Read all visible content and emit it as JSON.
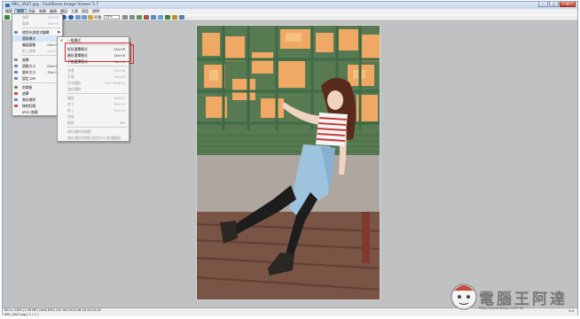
{
  "window": {
    "title": "IMG_3547.jpg - FastStone Image Viewer 5.7",
    "minimize": "—",
    "maximize": "□",
    "close": "✕"
  },
  "menubar": [
    "檔案",
    "編輯",
    "色彩",
    "效果",
    "檢視",
    "標記",
    "工具",
    "設定",
    "說明"
  ],
  "toolbar": {
    "zoom_value": "32%",
    "fit_label": "平滑"
  },
  "edit_menu": [
    {
      "label": "復原",
      "shortcut": "Ctrl+Z",
      "disabled": true
    },
    {
      "label": "重做",
      "shortcut": "Ctrl+Y",
      "disabled": true
    },
    {
      "label": "使用外部程式編輯",
      "shortcut": "",
      "disabled": false,
      "submenu": true
    },
    {
      "label": "選取模式",
      "shortcut": "",
      "disabled": false,
      "submenu": true,
      "highlight": true
    },
    {
      "label": "複製圖像",
      "shortcut": "Ctrl+C",
      "disabled": false
    },
    {
      "label": "貼上圖像",
      "shortcut": "Ctrl+V",
      "disabled": true
    },
    {
      "label": "旋轉",
      "shortcut": "",
      "disabled": false,
      "submenu": true
    },
    {
      "label": "調整大小",
      "shortcut": "Ctrl+R",
      "disabled": false
    },
    {
      "label": "畫布大小",
      "shortcut": "Ctrl+K",
      "disabled": false
    },
    {
      "label": "設定 DPI",
      "shortcut": "",
      "disabled": false
    },
    {
      "label": "剪裁板",
      "shortcut": "X",
      "disabled": false
    },
    {
      "label": "遮罩",
      "shortcut": "",
      "disabled": false
    },
    {
      "label": "美化移除",
      "shortcut": "",
      "disabled": false
    },
    {
      "label": "移除紅眼",
      "shortcut": "",
      "disabled": false
    },
    {
      "label": "JPEG 無損",
      "shortcut": "T",
      "disabled": false
    }
  ],
  "selection_submenu": [
    {
      "label": "一般模式",
      "shortcut": "",
      "checked": true,
      "disabled": false
    },
    {
      "label": "矩形選擇模式",
      "shortcut": "Ctrl+R",
      "disabled": false
    },
    {
      "label": "圓形選擇模式",
      "shortcut": "Ctrl+E",
      "disabled": false
    },
    {
      "label": "手繪選擇模式",
      "shortcut": "Ctrl+L",
      "disabled": false
    },
    {
      "label": "全選",
      "shortcut": "Ctrl+A",
      "disabled": true
    },
    {
      "label": "不選",
      "shortcut": "Ctrl+D",
      "disabled": true
    },
    {
      "label": "反向選取",
      "shortcut": "Ctrl+Shift+I",
      "disabled": true
    },
    {
      "label": "儲存選取",
      "shortcut": "",
      "disabled": true
    },
    {
      "label": "複製",
      "shortcut": "Ctrl+C",
      "disabled": true
    },
    {
      "label": "剪下",
      "shortcut": "Ctrl+X",
      "disabled": true
    },
    {
      "label": "貼上",
      "shortcut": "Ctrl+V",
      "disabled": true
    },
    {
      "label": "剪裁",
      "shortcut": "",
      "disabled": true
    },
    {
      "label": "刪除",
      "shortcut": "Del",
      "disabled": true
    },
    {
      "label": "儲存選取到檔案",
      "shortcut": "",
      "disabled": true
    },
    {
      "label": "儲存選取到檔案(使用JPEG無損壓縮)",
      "shortcut": "",
      "disabled": true
    }
  ],
  "status": {
    "info": "853 x 1280 (1.09 MP)  24bit  JPEG  241 KB  2015-06-18 00:14:00",
    "file": "IMG_3547.jpg [ 1 / 1 ]",
    "zoom": "6:4"
  },
  "watermark": {
    "text": "電腦王阿達",
    "url": "http://www.kocpc.com.tw"
  },
  "colors": {
    "highlight_box": "#d12c2c",
    "menu_highlight": "#d6e6f7"
  }
}
